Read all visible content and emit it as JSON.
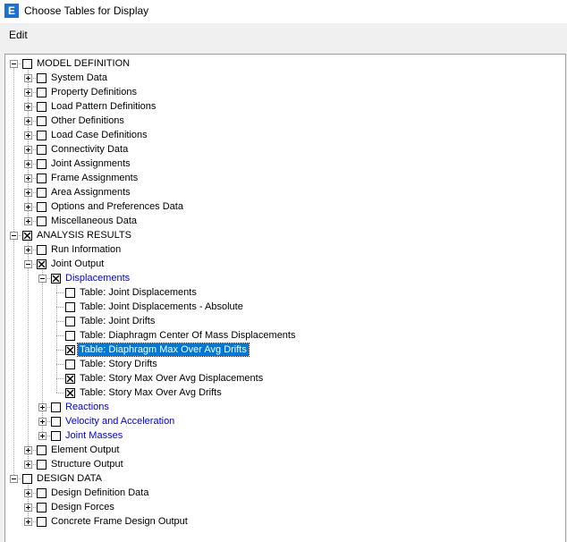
{
  "window": {
    "title": "Choose Tables for Display",
    "icon_letter": "E"
  },
  "menu": {
    "edit": "Edit"
  },
  "tree": [
    {
      "label": "MODEL DEFINITION",
      "level": 0,
      "exp": "minus",
      "checked": false
    },
    {
      "label": "System Data",
      "level": 1,
      "exp": "plus",
      "checked": false
    },
    {
      "label": "Property Definitions",
      "level": 1,
      "exp": "plus",
      "checked": false
    },
    {
      "label": "Load Pattern Definitions",
      "level": 1,
      "exp": "plus",
      "checked": false
    },
    {
      "label": "Other Definitions",
      "level": 1,
      "exp": "plus",
      "checked": false
    },
    {
      "label": "Load Case Definitions",
      "level": 1,
      "exp": "plus",
      "checked": false
    },
    {
      "label": "Connectivity Data",
      "level": 1,
      "exp": "plus",
      "checked": false
    },
    {
      "label": "Joint Assignments",
      "level": 1,
      "exp": "plus",
      "checked": false
    },
    {
      "label": "Frame Assignments",
      "level": 1,
      "exp": "plus",
      "checked": false
    },
    {
      "label": "Area Assignments",
      "level": 1,
      "exp": "plus",
      "checked": false
    },
    {
      "label": "Options and Preferences Data",
      "level": 1,
      "exp": "plus",
      "checked": false
    },
    {
      "label": "Miscellaneous Data",
      "level": 1,
      "exp": "plus",
      "checked": false
    },
    {
      "label": "ANALYSIS RESULTS",
      "level": 0,
      "exp": "minus",
      "checked": true
    },
    {
      "label": "Run Information",
      "level": 1,
      "exp": "plus",
      "checked": false
    },
    {
      "label": "Joint Output",
      "level": 1,
      "exp": "minus",
      "checked": true
    },
    {
      "label": "Displacements",
      "level": 2,
      "exp": "minus",
      "checked": true,
      "blue": true
    },
    {
      "label": "Table:  Joint Displacements",
      "level": 3,
      "exp": "",
      "checked": false
    },
    {
      "label": "Table:  Joint Displacements - Absolute",
      "level": 3,
      "exp": "",
      "checked": false
    },
    {
      "label": "Table:  Joint Drifts",
      "level": 3,
      "exp": "",
      "checked": false
    },
    {
      "label": "Table:  Diaphragm Center Of Mass Displacements",
      "level": 3,
      "exp": "",
      "checked": false
    },
    {
      "label": "Table:  Diaphragm Max Over Avg Drifts",
      "level": 3,
      "exp": "",
      "checked": true,
      "selected": true
    },
    {
      "label": "Table:  Story Drifts",
      "level": 3,
      "exp": "",
      "checked": false
    },
    {
      "label": "Table:  Story Max Over Avg Displacements",
      "level": 3,
      "exp": "",
      "checked": true
    },
    {
      "label": "Table:  Story Max Over Avg Drifts",
      "level": 3,
      "exp": "",
      "checked": true
    },
    {
      "label": "Reactions",
      "level": 2,
      "exp": "plus",
      "checked": false,
      "blue": true
    },
    {
      "label": "Velocity and Acceleration",
      "level": 2,
      "exp": "plus",
      "checked": false,
      "blue": true
    },
    {
      "label": "Joint Masses",
      "level": 2,
      "exp": "plus",
      "checked": false,
      "blue": true
    },
    {
      "label": "Element Output",
      "level": 1,
      "exp": "plus",
      "checked": false
    },
    {
      "label": "Structure Output",
      "level": 1,
      "exp": "plus",
      "checked": false
    },
    {
      "label": "DESIGN DATA",
      "level": 0,
      "exp": "minus",
      "checked": false
    },
    {
      "label": "Design Definition Data",
      "level": 1,
      "exp": "plus",
      "checked": false
    },
    {
      "label": "Design Forces",
      "level": 1,
      "exp": "plus",
      "checked": false
    },
    {
      "label": "Concrete Frame Design Output",
      "level": 1,
      "exp": "plus",
      "checked": false
    }
  ]
}
